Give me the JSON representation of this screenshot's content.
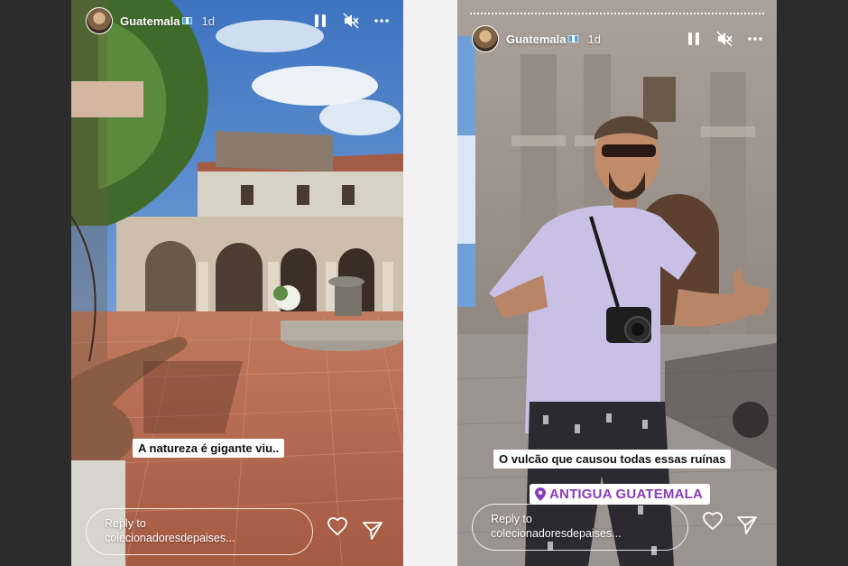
{
  "stories": [
    {
      "username": "Guatemala",
      "time": "1d",
      "caption": "A natureza é gigante viu..",
      "reply": {
        "line1": "Reply to",
        "line2": "colecionadoresdepaises..."
      }
    },
    {
      "username": "Guatemala",
      "time": "1d",
      "caption": "O vulcão que causou todas essas ruínas",
      "location": "ANTIGUA GUATEMALA",
      "reply": {
        "line1": "Reply to",
        "line2": "colecionadoresdepaises..."
      }
    }
  ],
  "icons": {
    "pause": "pause-icon",
    "mute": "muted-speaker-icon",
    "more": "more-horizontal-icon",
    "like": "heart-icon",
    "share": "send-icon",
    "location": "location-pin-icon",
    "flag": "guatemala-flag-icon"
  },
  "colors": {
    "location_text": "#8a3ab9",
    "brick": "#b5654a",
    "sky": "#4f86c6"
  }
}
